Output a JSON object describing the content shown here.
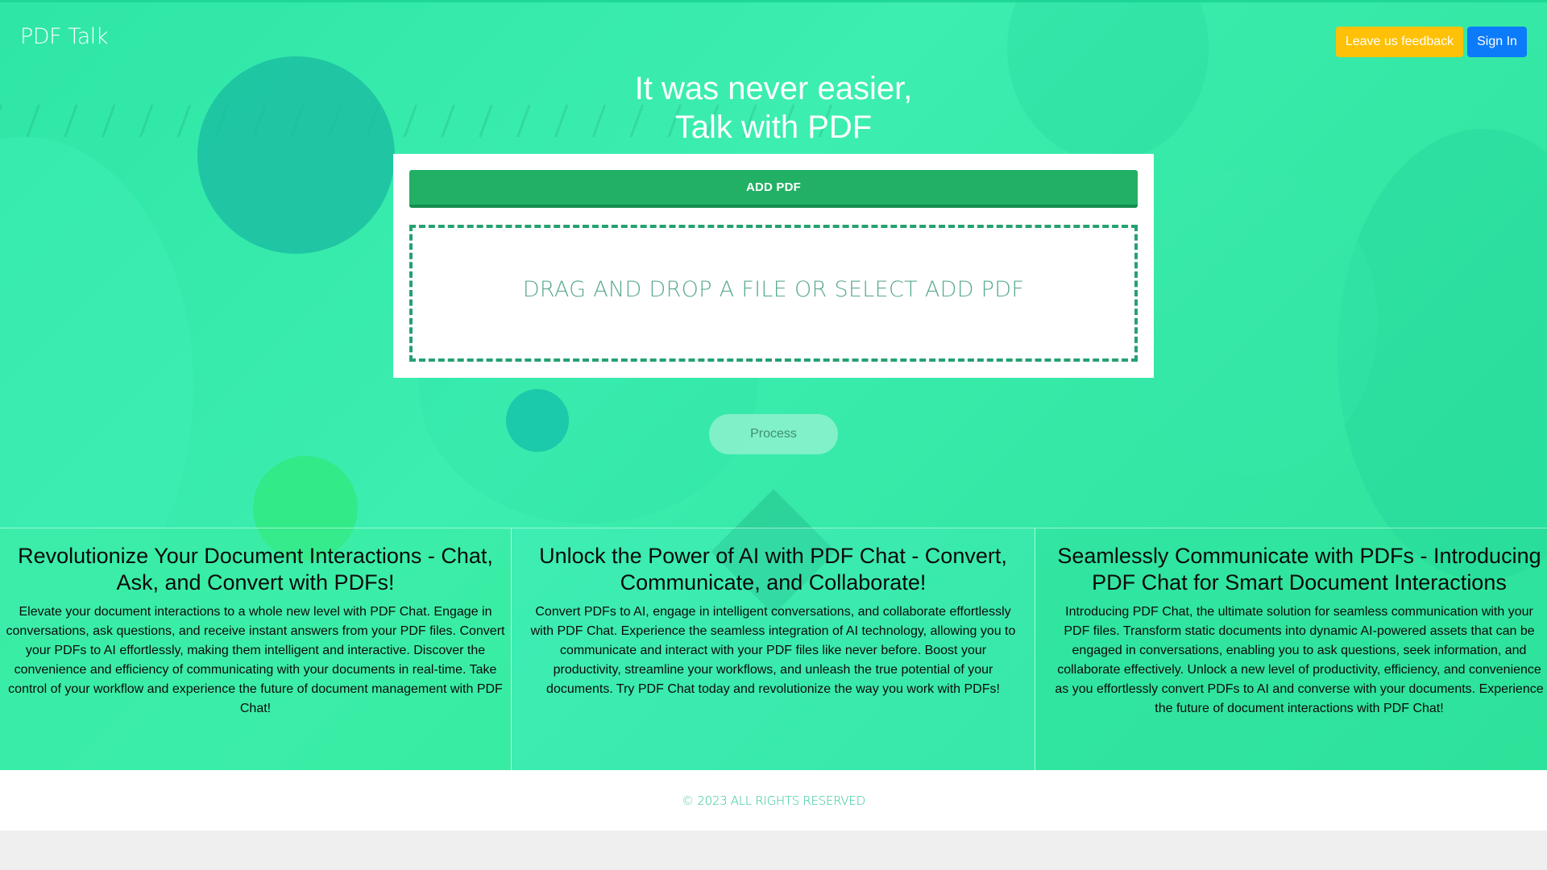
{
  "header": {
    "logo": "PDF Talk",
    "feedback_label": "Leave us feedback",
    "signin_label": "Sign In"
  },
  "hero": {
    "headline_line1": "It was never easier,",
    "headline_line2": "Talk with PDF"
  },
  "upload": {
    "add_pdf_label": "ADD PDF",
    "dropzone_text": "DRAG AND DROP A FILE OR SELECT ADD PDF"
  },
  "process_label": "Process",
  "features": [
    {
      "title": "Revolutionize Your Document Interactions - Chat, Ask, and Convert with PDFs!",
      "body": "Elevate your document interactions to a whole new level with PDF Chat. Engage in conversations, ask questions, and receive instant answers from your PDF files. Convert your PDFs to AI effortlessly, making them intelligent and interactive. Discover the convenience and efficiency of communicating with your documents in real-time. Take control of your workflow and experience the future of document management with PDF Chat!"
    },
    {
      "title": "Unlock the Power of AI with PDF Chat - Convert, Communicate, and Collaborate!",
      "body": "Convert PDFs to AI, engage in intelligent conversations, and collaborate effortlessly with PDF Chat. Experience the seamless integration of AI technology, allowing you to communicate and interact with your PDF files like never before. Boost your productivity, streamline your workflows, and unleash the true potential of your documents. Try PDF Chat today and revolutionize the way you work with PDFs!"
    },
    {
      "title": "Seamlessly Communicate with PDFs - Introducing PDF Chat for Smart Document Interactions",
      "body": "Introducing PDF Chat, the ultimate solution for seamless communication with your PDF files. Transform static documents into dynamic AI-powered assets that can be engaged in conversations, enabling you to ask questions, seek information, and collaborate effectively. Unlock a new level of productivity, efficiency, and convenience as you effortlessly convert PDFs to AI and converse with your documents. Experience the future of document interactions with PDF Chat!"
    }
  ],
  "footer": {
    "copyright": "© 2023 ALL RIGHTS RESERVED"
  },
  "colors": {
    "hero_green": "#34e8a8",
    "add_pdf_green": "#22b065",
    "feedback_yellow": "#fec107",
    "signin_blue": "#0b7bfa",
    "footer_text": "#2ec39a"
  }
}
